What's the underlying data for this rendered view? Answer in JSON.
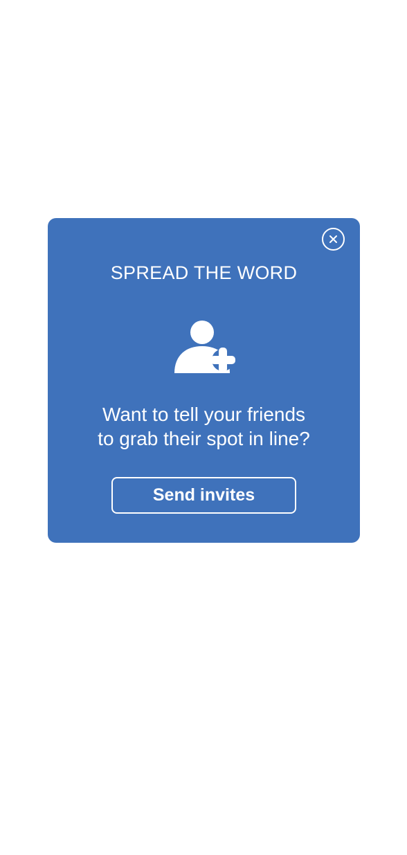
{
  "modal": {
    "title": "SPREAD THE WORD",
    "icon": "add-user-icon",
    "close_icon": "close-icon",
    "message_line1": "Want to tell your friends",
    "message_line2": "to grab their spot in line?",
    "send_label": "Send invites"
  },
  "colors": {
    "modal_background": "#3f72bb",
    "page_background": "#ffffff",
    "foreground": "#ffffff"
  }
}
